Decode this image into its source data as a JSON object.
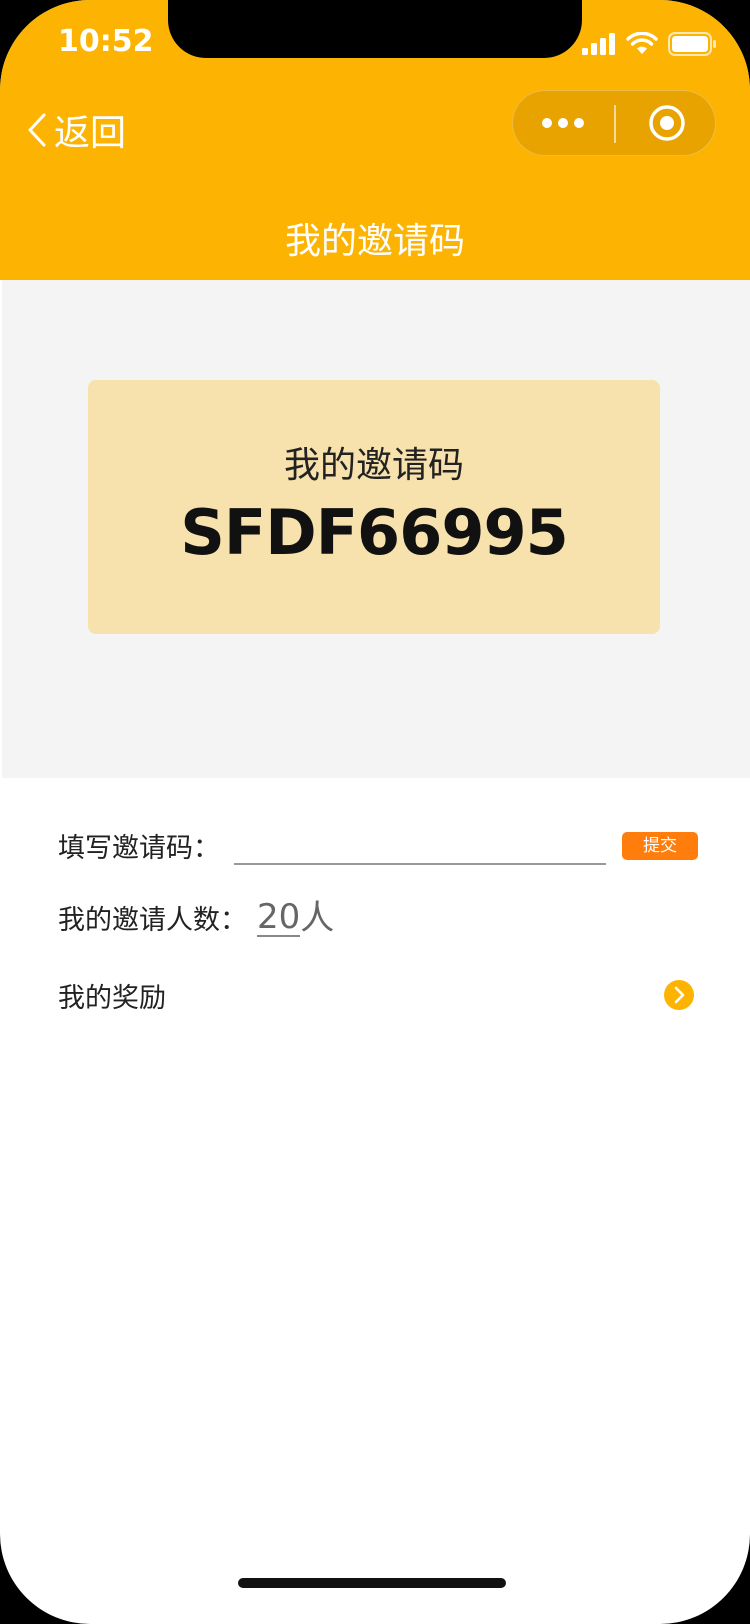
{
  "status_bar": {
    "time": "10:52"
  },
  "nav": {
    "back_label": "返回",
    "title": "我的邀请码",
    "icons": {
      "back": "chevron-left-icon",
      "more": "more-dots-icon",
      "close": "target-circle-icon"
    }
  },
  "invite_card": {
    "title": "我的邀请码",
    "code": "SFDF66995"
  },
  "form": {
    "invite_label": "填写邀请码：",
    "invite_value": "",
    "submit_label": "提交",
    "count_label": "我的邀请人数：",
    "count_value": "20",
    "count_unit": "人",
    "reward_label": "我的奖励",
    "reward_icon": "chevron-right-circle-icon"
  },
  "colors": {
    "brand": "#FDB302",
    "card": "#F7E2AD",
    "submit": "#FF7D0C"
  }
}
